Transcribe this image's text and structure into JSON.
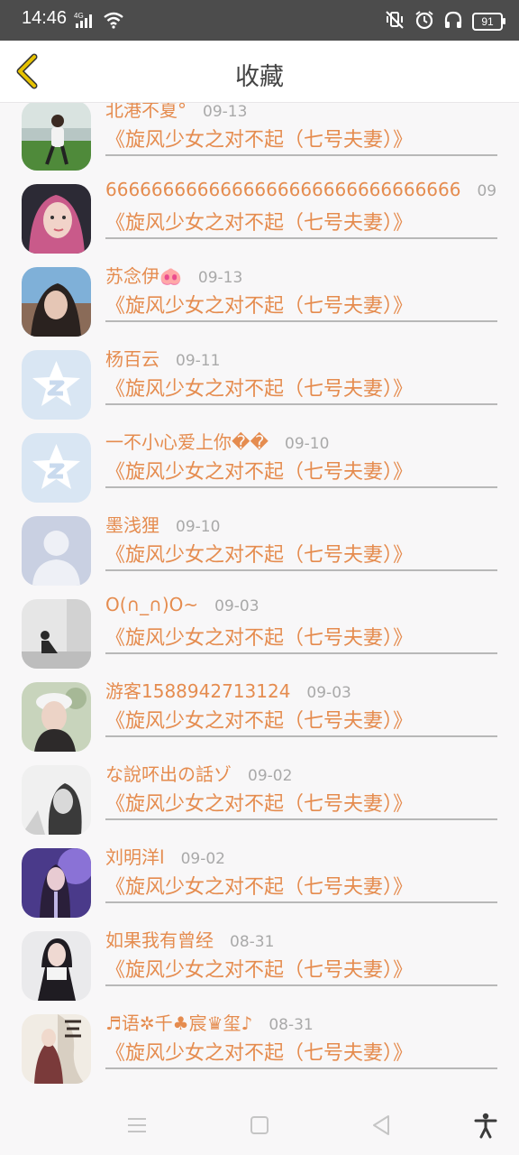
{
  "status_bar": {
    "time": "14:46",
    "network": "4G",
    "battery": "91"
  },
  "header": {
    "title": "收藏"
  },
  "items": [
    {
      "name": "北港不夏°",
      "date": "09-13",
      "book": "《旋风少女之对不起（七号夫妻）》",
      "avatar": "photo-girl-field"
    },
    {
      "name": "6666666666666666666666666666666",
      "date": "09",
      "book": "《旋风少女之对不起（七号夫妻）》",
      "avatar": "photo-girl-pink-hair"
    },
    {
      "name": "苏念伊🐽",
      "date": "09-13",
      "book": "《旋风少女之对不起（七号夫妻）》",
      "avatar": "photo-girl-selfie"
    },
    {
      "name": "杨百云",
      "date": "09-11",
      "book": "《旋风少女之对不起（七号夫妻）》",
      "avatar": "default-star-avatar"
    },
    {
      "name": "一不小心爱上你��",
      "date": "09-10",
      "book": "《旋风少女之对不起（七号夫妻）》",
      "avatar": "default-star-avatar"
    },
    {
      "name": "墨浅狸",
      "date": "09-10",
      "book": "《旋风少女之对不起（七号夫妻）》",
      "avatar": "default-person-avatar"
    },
    {
      "name": "O(∩_∩)O~",
      "date": "09-03",
      "book": "《旋风少女之对不起（七号夫妻）》",
      "avatar": "photo-person-wall"
    },
    {
      "name": "游客1588942713124",
      "date": "09-03",
      "book": "《旋风少女之对不起（七号夫妻）》",
      "avatar": "photo-girl-hat"
    },
    {
      "name": "な說吥出の話ゾ",
      "date": "09-02",
      "book": "《旋风少女之对不起（七号夫妻）》",
      "avatar": "photo-girl-bw"
    },
    {
      "name": "刘明洋l",
      "date": "09-02",
      "book": "《旋风少女之对不起（七号夫妻）》",
      "avatar": "photo-girl-purple"
    },
    {
      "name": "如果我有曾经",
      "date": "08-31",
      "book": "《旋风少女之对不起（七号夫妻）》",
      "avatar": "photo-girl-dark"
    },
    {
      "name": "♬语✲千♣宸♛玺♪",
      "date": "08-31",
      "book": "《旋风少女之对不起（七号夫妻）》",
      "avatar": "photo-drawing-poster"
    }
  ],
  "colors": {
    "accent": "#e58c4f",
    "back_arrow": "#e6c200",
    "date": "#a9a9a9"
  }
}
